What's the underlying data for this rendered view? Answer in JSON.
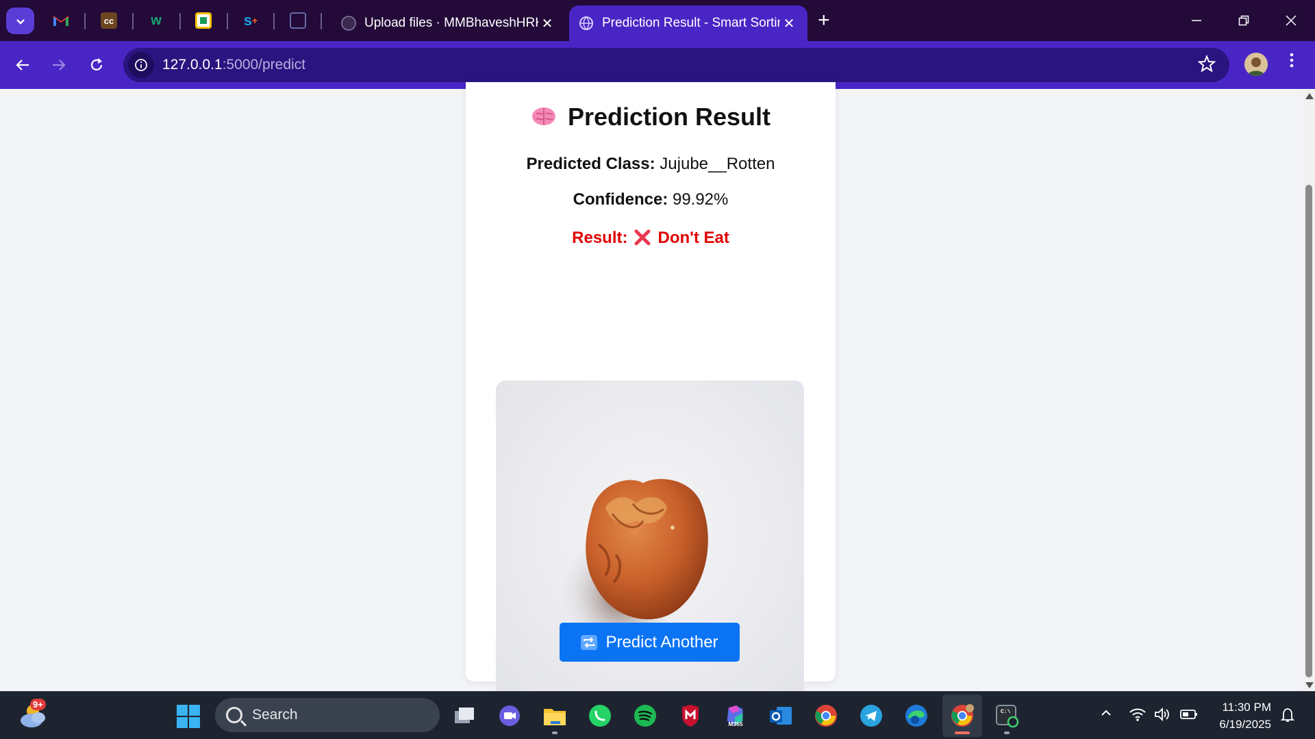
{
  "browser": {
    "pinned_tabs": [
      {
        "name": "gmail",
        "glyph": "M",
        "color": "#ea4335"
      },
      {
        "name": "cc",
        "glyph": "cc",
        "color": "#8a5a2b"
      },
      {
        "name": "w",
        "glyph": "w",
        "color": "#1aa36f"
      },
      {
        "name": "sheet",
        "glyph": "",
        "color": "#f5c400"
      },
      {
        "name": "s-plus",
        "glyph": "s",
        "color": "#1ba1e2"
      },
      {
        "name": "box",
        "glyph": "",
        "color": "#6a6aa8"
      }
    ],
    "tabs": [
      {
        "title": "Upload files · MMBhaveshHRK/",
        "active": false
      },
      {
        "title": "Prediction Result - Smart Sortin",
        "active": true
      }
    ],
    "url_host": "127.0.0.1",
    "url_path": ":5000/predict"
  },
  "page": {
    "heading": "Prediction Result",
    "predicted_label": "Predicted Class:",
    "predicted_value": "Jujube__Rotten",
    "confidence_label": "Confidence:",
    "confidence_value": "99.92%",
    "result_label": "Result:",
    "result_value": "Don't Eat",
    "button_label": "Predict Another"
  },
  "taskbar": {
    "weather_badge": "9+",
    "search_placeholder": "Search",
    "time": "11:30 PM",
    "date": "6/19/2025",
    "apps": [
      "file-explorer-icon",
      "meet-icon",
      "folder-icon",
      "whatsapp-icon",
      "spotify-icon",
      "mcafee-icon",
      "m365-icon",
      "outlook-icon",
      "chrome-icon",
      "telegram-icon",
      "edge-icon",
      "chrome-profile-icon",
      "terminal-icon"
    ]
  },
  "colors": {
    "tabstrip": "#230a38",
    "toolbar": "#4a25c6",
    "result_red": "#e00000",
    "button_blue": "#0b74f4"
  }
}
